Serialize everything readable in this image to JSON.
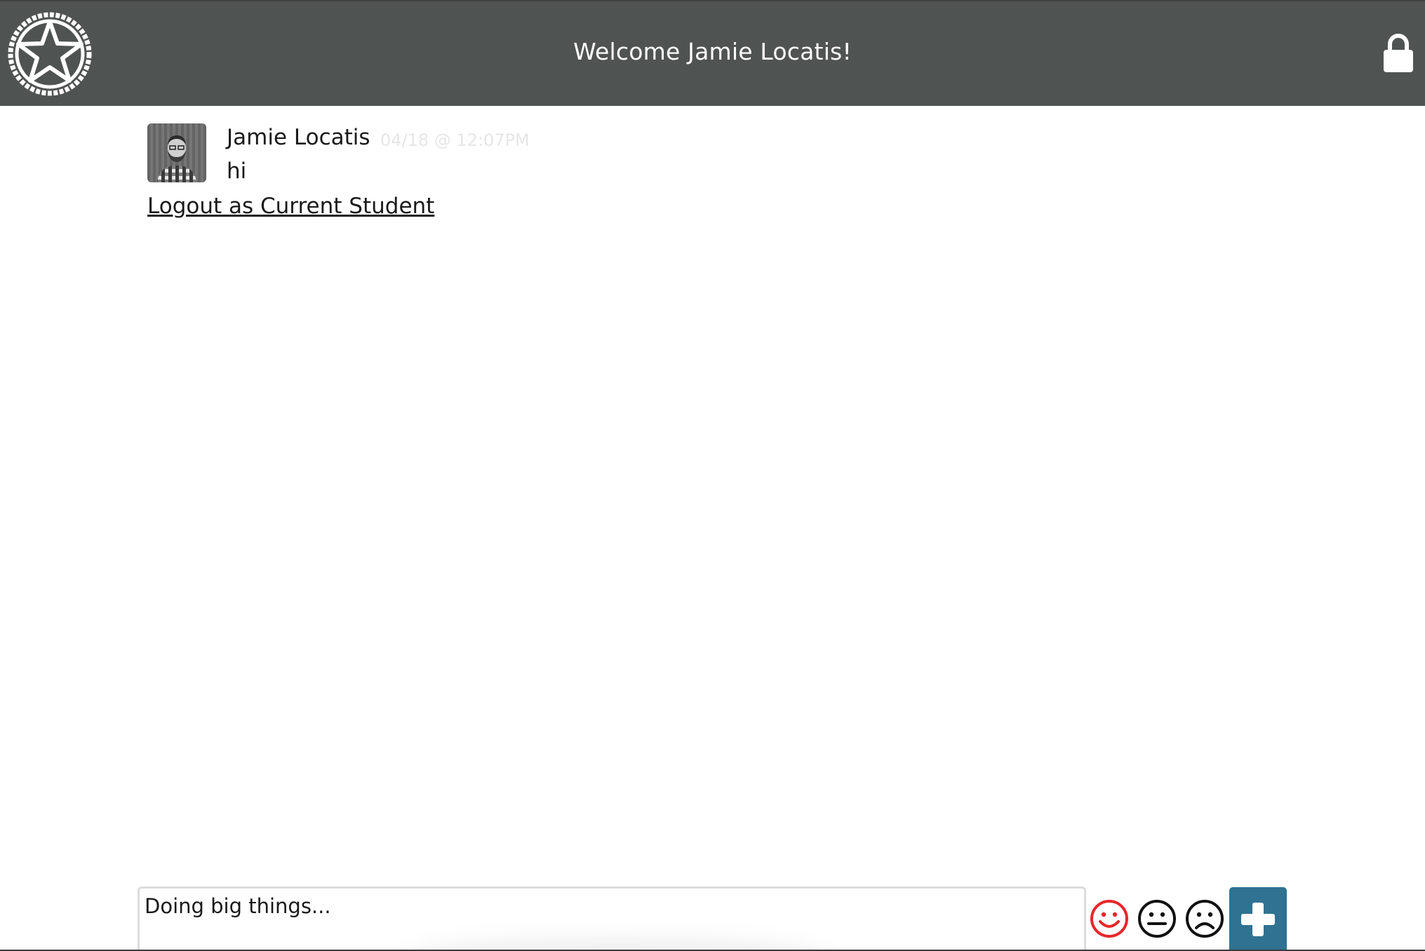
{
  "header": {
    "logo_icon": "star-wheel-logo-icon",
    "welcome_text": "Welcome Jamie Locatis!",
    "lock_icon": "lock-icon",
    "background_color": "#4f5352"
  },
  "feed": {
    "posts": [
      {
        "author": "Jamie Locatis",
        "timestamp": "04/18 @ 12:07PM",
        "message": "hi",
        "avatar_icon": "user-avatar"
      }
    ],
    "logout_link": "Logout as Current Student"
  },
  "composer": {
    "value": "Doing big things...",
    "moods": [
      {
        "name": "happy",
        "icon": "smiley-face-icon",
        "color": "#e8262b",
        "selected": true
      },
      {
        "name": "neutral",
        "icon": "neutral-face-icon",
        "color": "#111111",
        "selected": false
      },
      {
        "name": "sad",
        "icon": "frown-face-icon",
        "color": "#111111",
        "selected": false
      }
    ],
    "add_icon": "plus-icon",
    "add_button_color": "#2f7291"
  }
}
